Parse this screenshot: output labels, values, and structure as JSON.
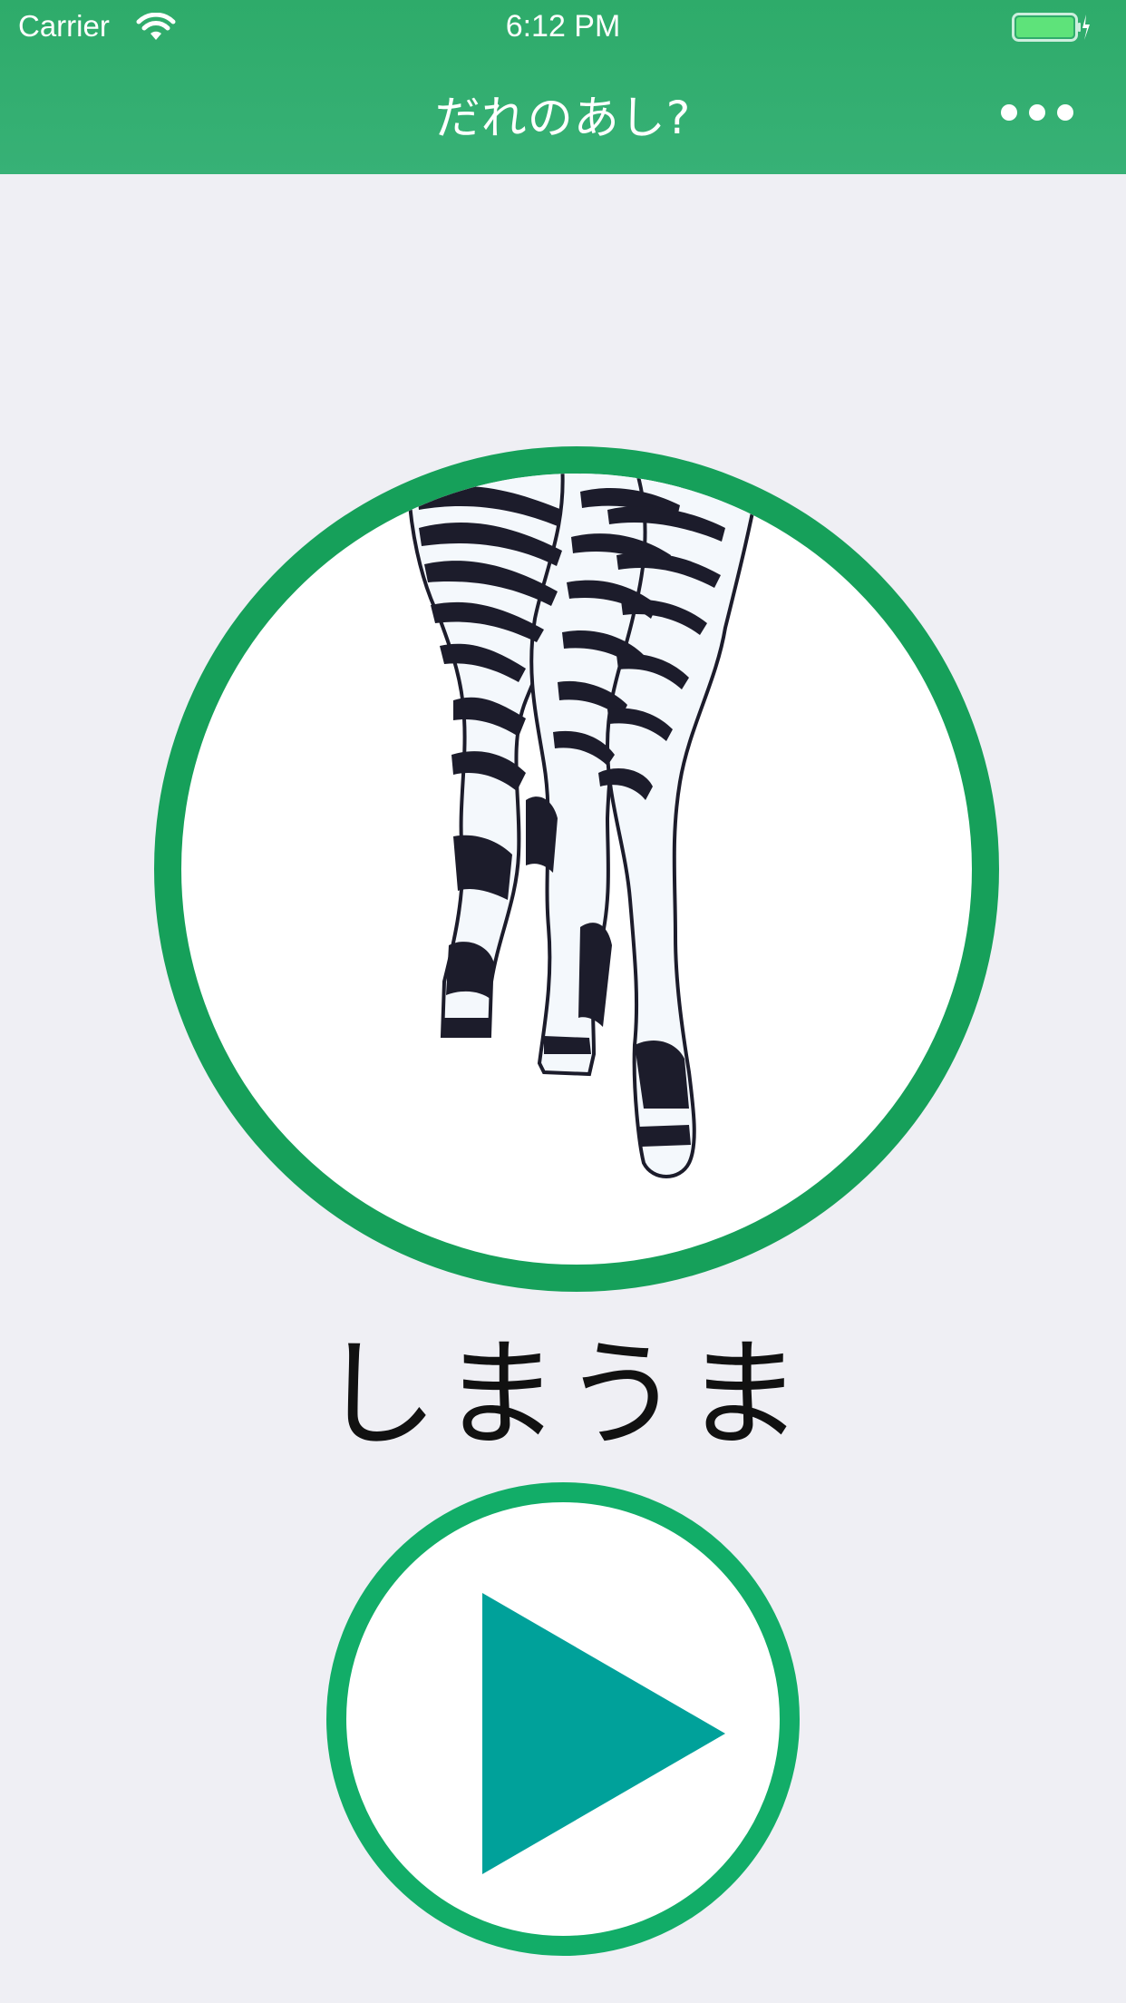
{
  "status_bar": {
    "carrier": "Carrier",
    "time": "6:12 PM",
    "wifi_icon": "wifi-icon",
    "battery_icon": "battery-charging-icon"
  },
  "nav": {
    "title": "だれのあし?",
    "more_icon": "more-dots-icon"
  },
  "main": {
    "image_subject": "zebra-legs-illustration",
    "answer": "しまうま",
    "play_icon": "play-icon"
  },
  "colors": {
    "header_green": "#2eab6a",
    "ring_green": "#16a05a",
    "play_ring_green": "#12ad68",
    "play_triangle_teal": "#00a19a",
    "background": "#efeff4"
  }
}
